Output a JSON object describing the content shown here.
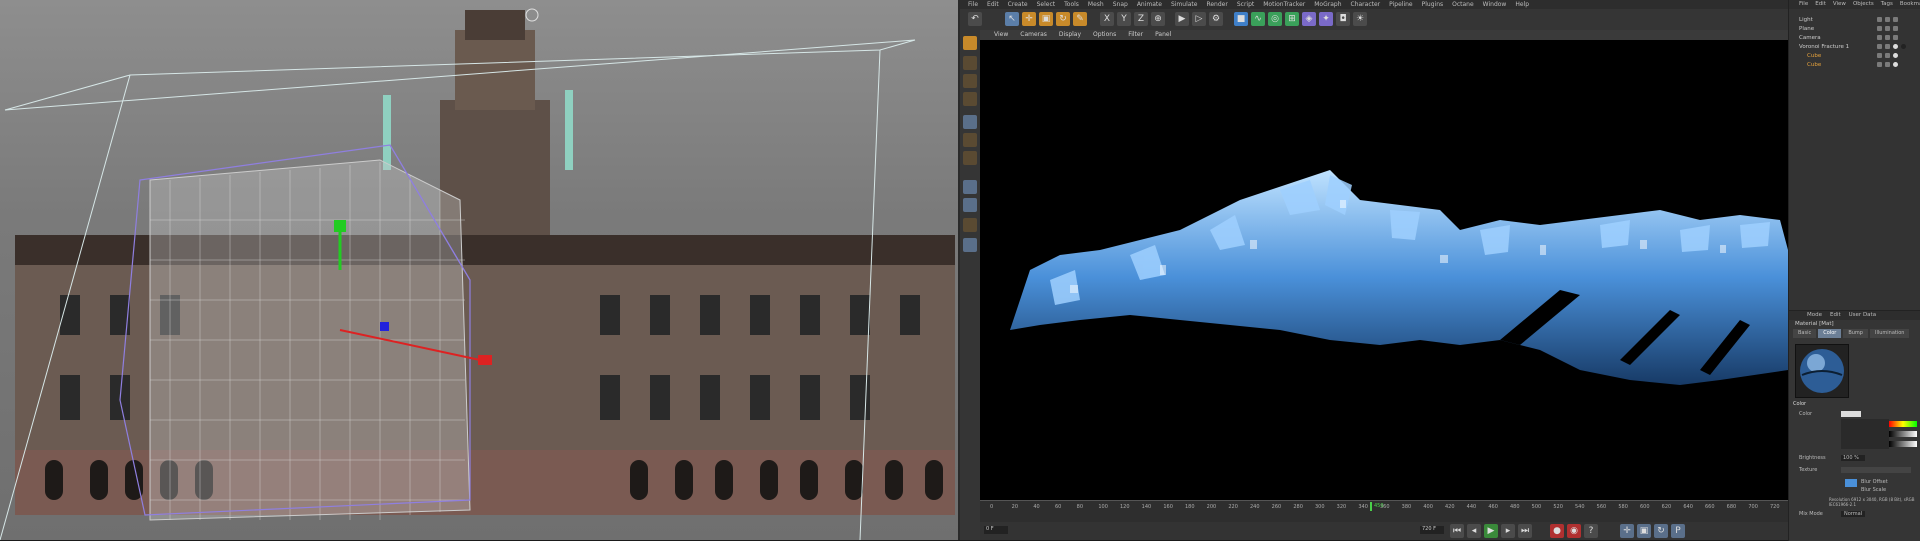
{
  "menubar": [
    "File",
    "Edit",
    "Create",
    "Select",
    "Tools",
    "Mesh",
    "Snap",
    "Animate",
    "Simulate",
    "Render",
    "Script",
    "MotionTracker",
    "MoGraph",
    "Character",
    "Pipeline",
    "Plugins",
    "Octane",
    "Window",
    "Help"
  ],
  "viewport_menu": [
    "View",
    "Cameras",
    "Display",
    "Options",
    "Filter",
    "Panel"
  ],
  "toolbar_axes": [
    "X",
    "Y",
    "Z"
  ],
  "object_manager": {
    "menu": [
      "File",
      "Edit",
      "View",
      "Objects",
      "Tags",
      "Bookmarks"
    ],
    "objects": [
      {
        "name": "Light",
        "selected": false
      },
      {
        "name": "Plane",
        "selected": false
      },
      {
        "name": "Camera",
        "selected": false
      },
      {
        "name": "Voronoi Fracture 1",
        "selected": false
      },
      {
        "name": "Cube",
        "selected": true
      },
      {
        "name": "Cube",
        "selected": true
      }
    ]
  },
  "attributes": {
    "menu": [
      "Mode",
      "Edit",
      "User Data"
    ],
    "material_name": "Material [Mat]",
    "tabs": [
      "Basic",
      "Color",
      "Bump",
      "Illumination"
    ],
    "active_tab": "Color",
    "section": "Color",
    "color_label": "Color",
    "brightness_label": "Brightness",
    "brightness_value": "100 %",
    "texture_label": "Texture",
    "mix_mode_label": "Mix Mode",
    "mix_mode_value": "Normal",
    "blur_offset": "Blur Offset",
    "blur_scale": "Blur Scale",
    "resolution": "Resolution 6912 x 3040, RGB (8 Bit), sRGB IEC61966-2.1"
  },
  "timeline": {
    "ticks": [
      "0",
      "20",
      "40",
      "60",
      "80",
      "100",
      "120",
      "140",
      "160",
      "180",
      "200",
      "220",
      "240",
      "260",
      "280",
      "300",
      "320",
      "340",
      "360",
      "380",
      "400",
      "420",
      "440",
      "460",
      "480",
      "500",
      "520",
      "540",
      "560",
      "580",
      "600",
      "620",
      "640",
      "660",
      "680",
      "700",
      "720"
    ],
    "current_frame": "450",
    "start_field": "0 F",
    "end_field": "720 F"
  },
  "colors": {
    "selection_orange": "#e6a23c",
    "shard_blue": "#4a90d9",
    "active_tab": "#6c7f96",
    "render_bg": "#000000"
  }
}
